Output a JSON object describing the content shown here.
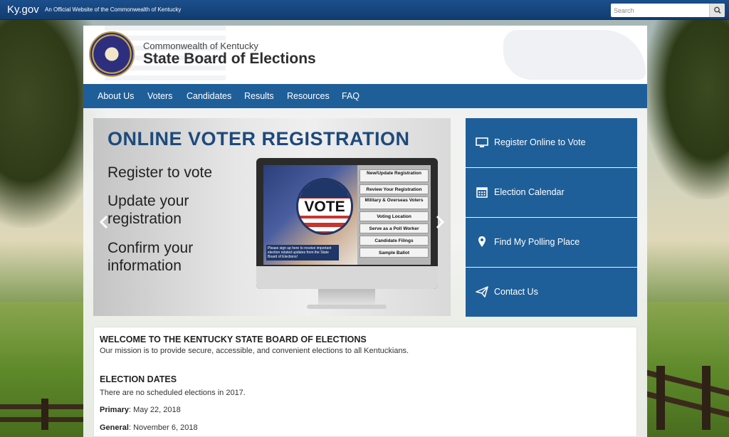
{
  "topbar": {
    "site": "Ky.gov",
    "tagline": "An Official Website of the Commonwealth of Kentucky",
    "search_placeholder": "Search"
  },
  "header": {
    "subtitle": "Commonwealth of Kentucky",
    "title": "State Board of Elections"
  },
  "nav": {
    "items": [
      "About Us",
      "Voters",
      "Candidates",
      "Results",
      "Resources",
      "FAQ"
    ]
  },
  "carousel": {
    "title": "ONLINE VOTER REGISTRATION",
    "lines": [
      "Register to vote",
      "Update your registration",
      "Confirm your information"
    ],
    "vote_badge": "VOTE",
    "screen_caption": "Please sign up here to receive important election related updates from the State Board of Elections!",
    "screen_menu": [
      "New/Update Registration",
      "Review Your Registration",
      "Military & Overseas Voters",
      "Voting Location",
      "Serve as a Poll Worker",
      "Candidate Filings",
      "Sample Ballot"
    ],
    "prev_icon": "chevron-left-icon",
    "next_icon": "chevron-right-icon"
  },
  "quicklinks": [
    {
      "label": "Register Online to Vote",
      "icon": "monitor-icon"
    },
    {
      "label": "Election Calendar",
      "icon": "calendar-icon"
    },
    {
      "label": "Find My Polling Place",
      "icon": "map-pin-icon"
    },
    {
      "label": "Contact Us",
      "icon": "paper-plane-icon"
    }
  ],
  "content": {
    "welcome_title": "WELCOME TO THE KENTUCKY STATE BOARD OF ELECTIONS",
    "mission": "Our mission is to provide secure, accessible, and convenient elections to all Kentuckians.",
    "dates_title": "ELECTION DATES",
    "no_elections": "There are no scheduled elections in 2017.",
    "primary_label": "Primary",
    "primary_date": ": May 22, 2018",
    "general_label": "General",
    "general_date": ": November 6, 2018"
  },
  "colors": {
    "topbar": "#123c70",
    "nav": "#1f5f99",
    "quicklink": "#1f5f99",
    "title_blue": "#1d4a7c"
  }
}
